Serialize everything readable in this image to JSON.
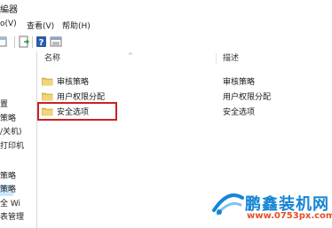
{
  "window": {
    "title_fragment": "編器"
  },
  "menu": {
    "items": [
      {
        "label": "o(V)"
      },
      {
        "label": "查看(V)"
      },
      {
        "label": "帮助(H)"
      }
    ]
  },
  "toolbar": {
    "icons": [
      "back-icon",
      "export-list-icon",
      "help-icon",
      "properties-icon"
    ]
  },
  "tree": {
    "items": [
      {
        "label": "置"
      },
      {
        "label": "策略"
      },
      {
        "label": "/关机)"
      },
      {
        "label": "打印机"
      },
      {
        "label": "策略"
      },
      {
        "label": "策略"
      },
      {
        "label": "全 Wi"
      },
      {
        "label": "表管理"
      }
    ]
  },
  "list": {
    "columns": [
      {
        "label": "名称"
      },
      {
        "label": "描述"
      }
    ],
    "rows": [
      {
        "name": "审核策略",
        "description": "审核策略"
      },
      {
        "name": "用户权限分配",
        "description": "用户权限分配"
      },
      {
        "name": "安全选项",
        "description": "安全选项"
      }
    ],
    "highlighted_row": "安全选项"
  },
  "colors": {
    "highlight_border": "#cc2222",
    "selection": "#cce8ff",
    "watermark_blue": "#1585d6",
    "watermark_orange": "#e0512a"
  },
  "watermark": {
    "brand": "鹏鑫装机网",
    "url": "www.0753px.com"
  }
}
